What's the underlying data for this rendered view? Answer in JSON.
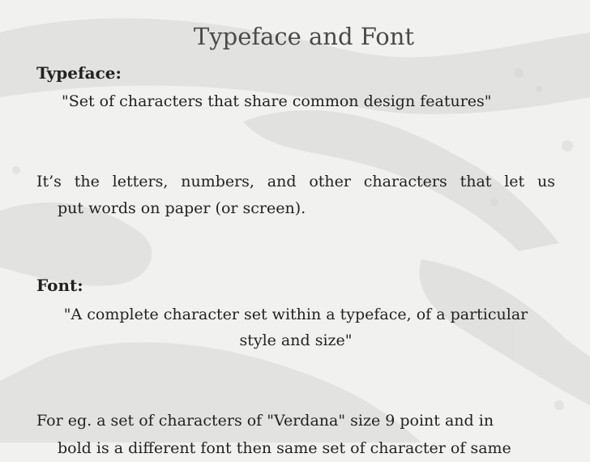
{
  "slide": {
    "title": "Typeface and Font",
    "typeface_label": "Typeface:",
    "typeface_definition": "\"Set of characters that share common design features\"",
    "typeface_explanation_line1": "It’s the letters, numbers, and other characters that let us",
    "typeface_explanation_line2": "put words on paper (or screen).",
    "font_label": "Font:",
    "font_definition_line1": "\"A complete character set within a typeface, of a particular",
    "font_definition_line2": "style and size\"",
    "example_line1": "For eg. a set of characters of \"Verdana\" size 9 point and in",
    "example_line2": "bold is a different font then same set of character of same"
  },
  "colors": {
    "background": "#f1f1f0",
    "brush_strokes": "#dcdcdb",
    "title_text": "#4a4a4a",
    "body_text": "#222222"
  }
}
